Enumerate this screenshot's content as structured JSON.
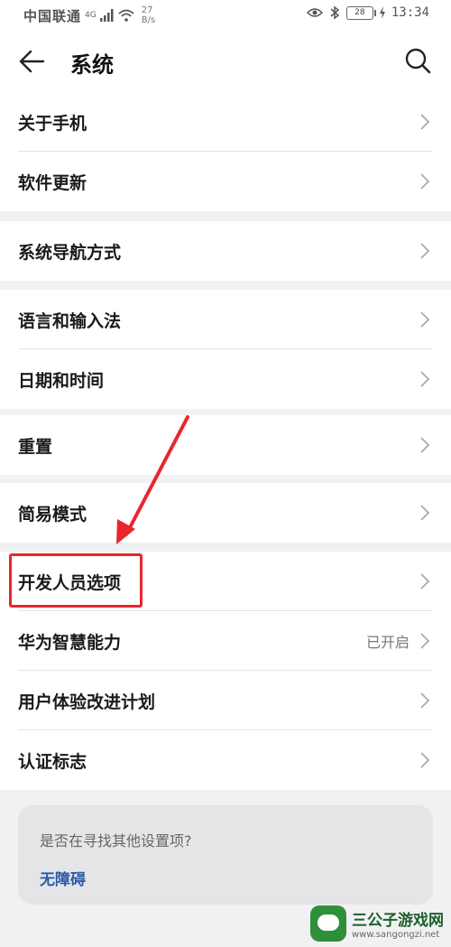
{
  "status_bar": {
    "carrier": "中国联通",
    "network": "4G",
    "speed_value": "27",
    "speed_unit": "B/s",
    "battery": "28",
    "time": "13:34"
  },
  "header": {
    "title": "系统"
  },
  "groups": [
    {
      "items": [
        {
          "label": "关于手机"
        },
        {
          "label": "软件更新"
        }
      ]
    },
    {
      "items": [
        {
          "label": "系统导航方式"
        }
      ]
    },
    {
      "items": [
        {
          "label": "语言和输入法"
        },
        {
          "label": "日期和时间"
        }
      ]
    },
    {
      "items": [
        {
          "label": "重置"
        }
      ]
    },
    {
      "items": [
        {
          "label": "简易模式"
        },
        {
          "label": "开发人员选项",
          "highlighted": true
        },
        {
          "label": "华为智慧能力",
          "value": "已开启"
        },
        {
          "label": "用户体验改进计划"
        },
        {
          "label": "认证标志"
        }
      ]
    }
  ],
  "help_card": {
    "question": "是否在寻找其他设置项?",
    "link": "无障碍"
  },
  "watermark": {
    "name": "三公子游戏网",
    "url": "www.sangongzi.net"
  },
  "colors": {
    "highlight": "#e8262e",
    "link": "#2d5aa8",
    "background": "#f1f1f3"
  }
}
